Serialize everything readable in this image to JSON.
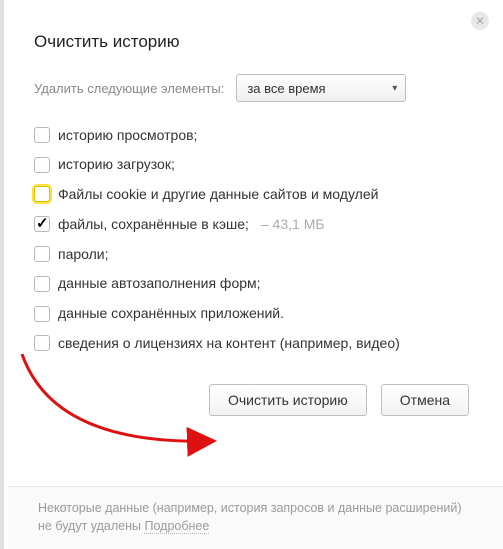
{
  "title": "Очистить историю",
  "timerange": {
    "label": "Удалить следующие элементы:",
    "selected": "за все время"
  },
  "options": [
    {
      "label": "историю просмотров;",
      "checked": false,
      "highlight": false
    },
    {
      "label": "историю загрузок;",
      "checked": false,
      "highlight": false
    },
    {
      "label": "Файлы cookie и другие данные сайтов и модулей",
      "checked": false,
      "highlight": true
    },
    {
      "label": "файлы, сохранённые в кэше;",
      "extra": "–  43,1 МБ",
      "checked": true,
      "highlight": false
    },
    {
      "label": "пароли;",
      "checked": false,
      "highlight": false
    },
    {
      "label": "данные автозаполнения форм;",
      "checked": false,
      "highlight": false
    },
    {
      "label": "данные сохранённых приложений.",
      "checked": false,
      "highlight": false
    },
    {
      "label": "сведения о лицензиях на контент (например, видео)",
      "checked": false,
      "highlight": false
    }
  ],
  "buttons": {
    "clear": "Очистить историю",
    "cancel": "Отмена"
  },
  "footer": {
    "text_a": "Некоторые данные (например, история запросов и данные расширений) не будут удалены ",
    "link": "Подробнее"
  }
}
